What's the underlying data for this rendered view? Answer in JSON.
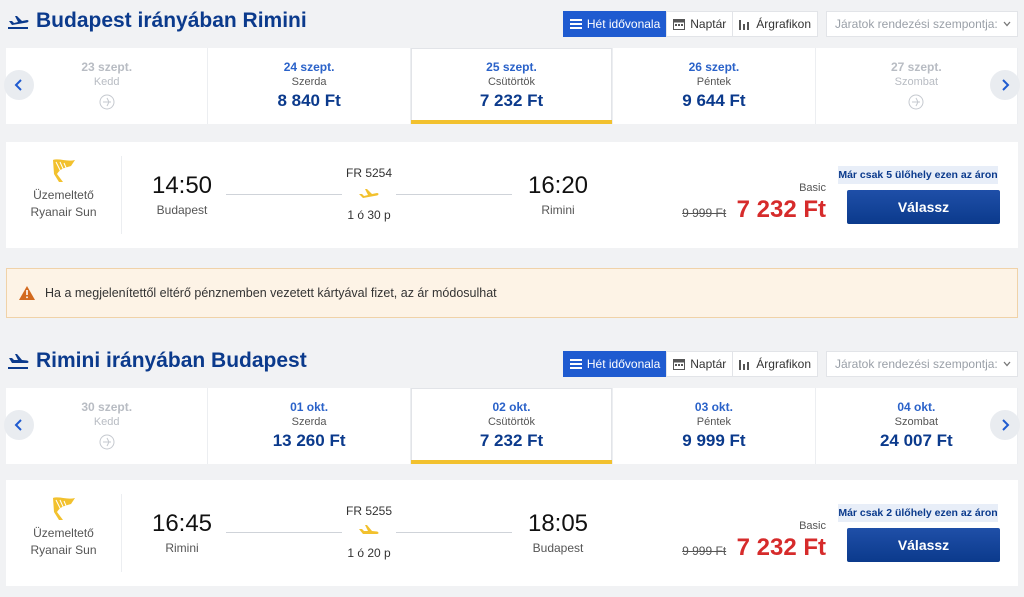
{
  "view_buttons": {
    "timeline": "Hét idővonala",
    "calendar": "Naptár",
    "price_chart": "Árgrafikon"
  },
  "sort_placeholder": "Járatok rendezési szempontja:",
  "outbound": {
    "title": "Budapest irányában Rimini",
    "dates": [
      {
        "date": "23 szept.",
        "weekday": "Kedd",
        "price": "",
        "disabled": true
      },
      {
        "date": "24 szept.",
        "weekday": "Szerda",
        "price": "8 840 Ft"
      },
      {
        "date": "25 szept.",
        "weekday": "Csütörtök",
        "price": "7 232 Ft",
        "selected": true
      },
      {
        "date": "26 szept.",
        "weekday": "Péntek",
        "price": "9 644 Ft"
      },
      {
        "date": "27 szept.",
        "weekday": "Szombat",
        "price": "",
        "disabled": true
      }
    ],
    "flight": {
      "operator_line1": "Üzemeltető",
      "operator_line2": "Ryanair Sun",
      "dep_time": "14:50",
      "dep_city": "Budapest",
      "arr_time": "16:20",
      "arr_city": "Rimini",
      "flight_no": "FR 5254",
      "duration": "1 ó 30 p",
      "fare_class": "Basic",
      "old_price": "9 999 Ft",
      "price": "7 232 Ft",
      "seats_note": "Már csak 5 ülőhely ezen az áron",
      "choose": "Válassz"
    }
  },
  "warning": "Ha a megjelenítettől eltérő pénznemben vezetett kártyával fizet, az ár módosulhat",
  "inbound": {
    "title": "Rimini irányában Budapest",
    "dates": [
      {
        "date": "30 szept.",
        "weekday": "Kedd",
        "price": "",
        "disabled": true
      },
      {
        "date": "01 okt.",
        "weekday": "Szerda",
        "price": "13 260 Ft"
      },
      {
        "date": "02 okt.",
        "weekday": "Csütörtök",
        "price": "7 232 Ft",
        "selected": true
      },
      {
        "date": "03 okt.",
        "weekday": "Péntek",
        "price": "9 999 Ft"
      },
      {
        "date": "04 okt.",
        "weekday": "Szombat",
        "price": "24 007 Ft"
      }
    ],
    "flight": {
      "operator_line1": "Üzemeltető",
      "operator_line2": "Ryanair Sun",
      "dep_time": "16:45",
      "dep_city": "Rimini",
      "arr_time": "18:05",
      "arr_city": "Budapest",
      "flight_no": "FR 5255",
      "duration": "1 ó 20 p",
      "fare_class": "Basic",
      "old_price": "9 999 Ft",
      "price": "7 232 Ft",
      "seats_note": "Már csak 2 ülőhely ezen az áron",
      "choose": "Válassz"
    }
  },
  "colors": {
    "brand": "#0b3a8c",
    "accent": "#1f5bd0",
    "price_red": "#d62b2b",
    "selected_bar": "#f2c12e",
    "plane_yellow": "#f2c12e"
  }
}
